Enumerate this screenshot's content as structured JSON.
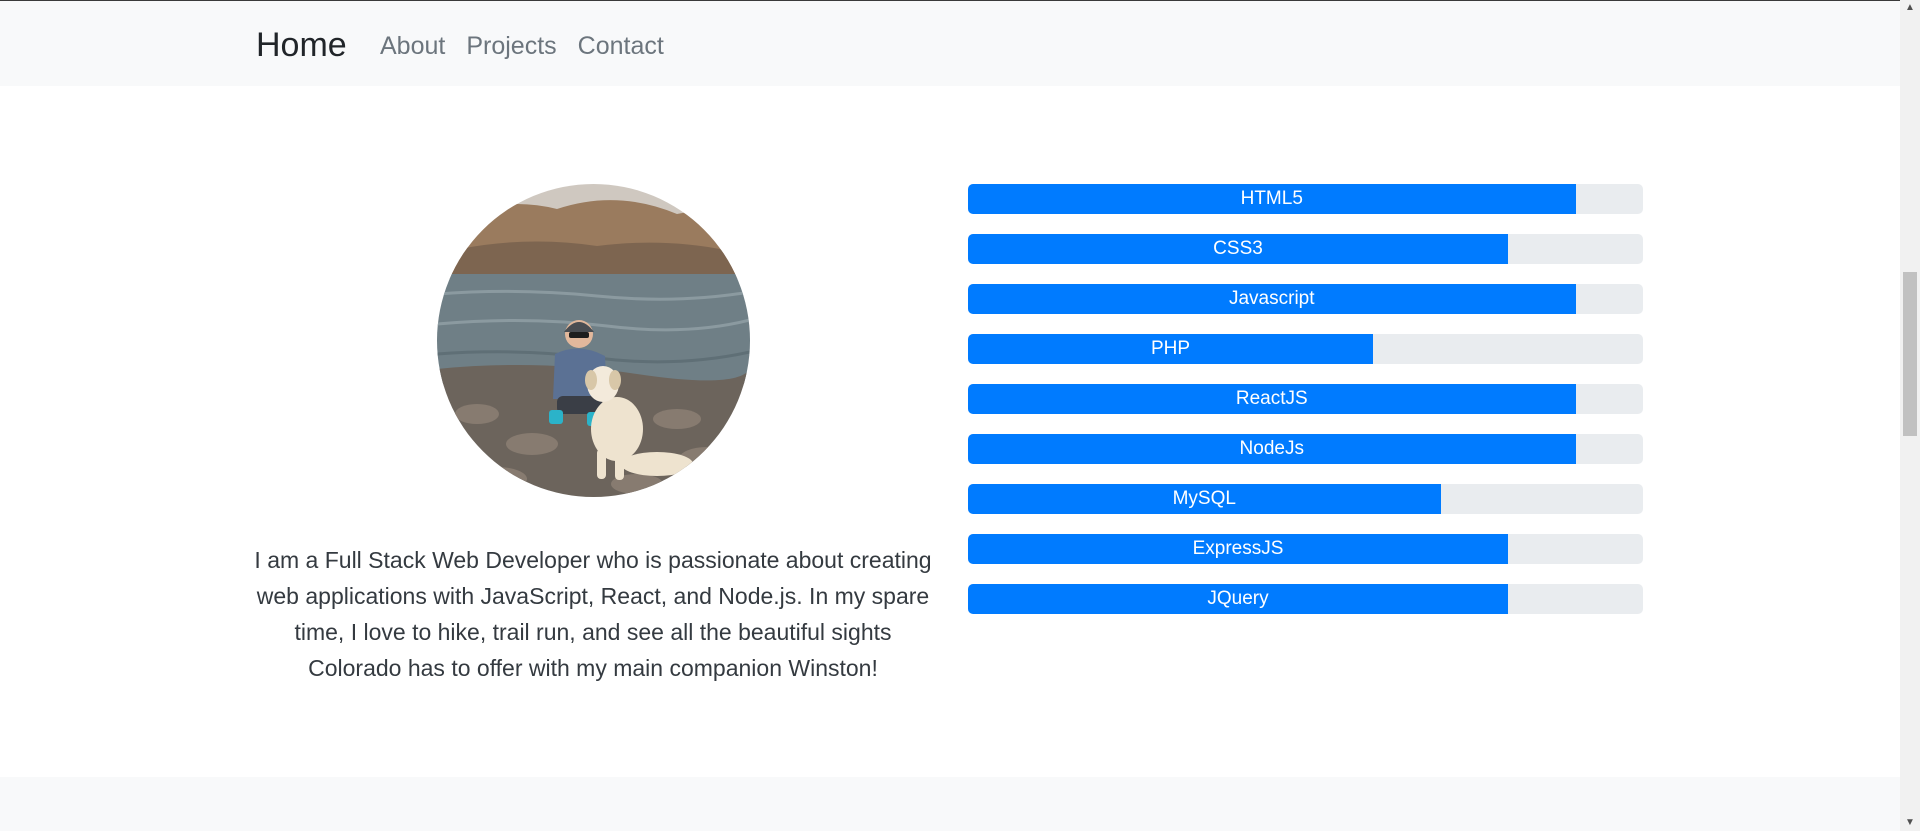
{
  "nav": {
    "brand": "Home",
    "links": [
      "About",
      "Projects",
      "Contact"
    ]
  },
  "profile": {
    "image_alt": "Person crouching with a white dog by a mountain lake",
    "bio": "I am a Full Stack Web Developer who is passionate about creating web applications with JavaScript, React, and Node.js. In my spare time, I love to hike, trail run, and see all the beautiful sights Colorado has to offer with my main companion Winston!"
  },
  "skills": [
    {
      "label": "HTML5",
      "percent": 90
    },
    {
      "label": "CSS3",
      "percent": 80
    },
    {
      "label": "Javascript",
      "percent": 90
    },
    {
      "label": "PHP",
      "percent": 60
    },
    {
      "label": "ReactJS",
      "percent": 90
    },
    {
      "label": "NodeJs",
      "percent": 90
    },
    {
      "label": "MySQL",
      "percent": 70
    },
    {
      "label": "ExpressJS",
      "percent": 80
    },
    {
      "label": "JQuery",
      "percent": 80
    }
  ],
  "colors": {
    "primary": "#007bff",
    "progress_track": "#e9ecef",
    "navbar_bg": "#f8f9fa"
  },
  "icons": {
    "scroll_up": "scroll-up-arrow-icon",
    "scroll_down": "scroll-down-arrow-icon"
  }
}
